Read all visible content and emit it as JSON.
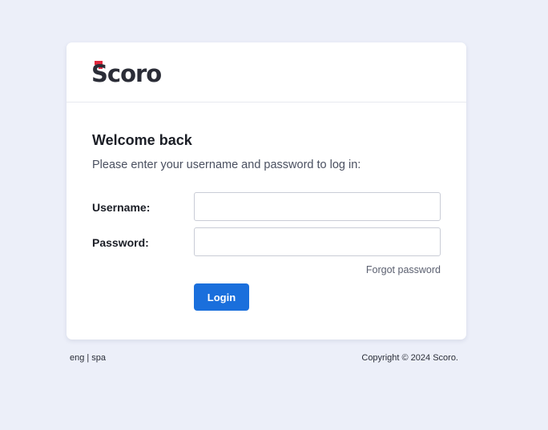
{
  "brand": {
    "name": "Scoro",
    "accent_color": "#e0283d",
    "logo_text_color": "#2b2d37"
  },
  "login": {
    "title": "Welcome back",
    "subtitle": "Please enter your username and password to log in:",
    "username_label": "Username:",
    "username_value": "",
    "password_label": "Password:",
    "password_value": "",
    "forgot_password": "Forgot password",
    "login_button": "Login",
    "button_color": "#1a6fdc"
  },
  "footer": {
    "languages": [
      "eng",
      "spa"
    ],
    "separator": "|",
    "copyright": "Copyright © 2024 Scoro."
  },
  "colors": {
    "page_background": "#eceff9",
    "card_background": "#ffffff"
  }
}
